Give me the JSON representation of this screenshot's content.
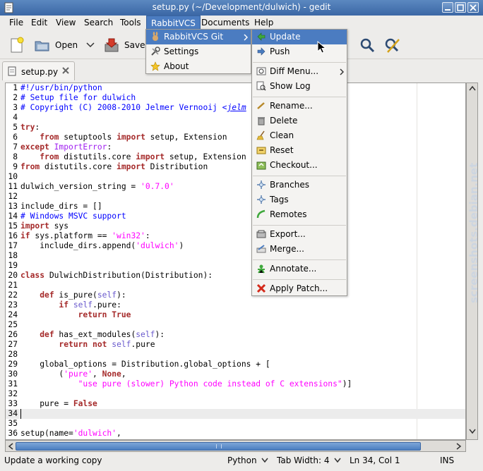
{
  "window": {
    "title": "setup.py (~/Development/dulwich) - gedit"
  },
  "menubar": {
    "items": [
      "File",
      "Edit",
      "View",
      "Search",
      "Tools",
      "RabbitVCS",
      "Documents",
      "Help"
    ]
  },
  "toolbar": {
    "open_label": "Open",
    "save_label": "Save"
  },
  "tab": {
    "filename": "setup.py"
  },
  "rabbitvcs_menu": {
    "items": [
      "RabbitVCS Git",
      "Settings",
      "About"
    ]
  },
  "git_submenu": {
    "items": [
      "Update",
      "Push",
      "Diff Menu...",
      "Show Log",
      "Rename...",
      "Delete",
      "Clean",
      "Reset",
      "Checkout...",
      "Branches",
      "Tags",
      "Remotes",
      "Export...",
      "Merge...",
      "Annotate...",
      "Apply Patch..."
    ]
  },
  "code": {
    "lines": [
      "#!/usr/bin/python",
      "# Setup file for dulwich",
      "# Copyright (C) 2008-2010 Jelmer Vernooij <jelm",
      "",
      "try:",
      "    from setuptools import setup, Extension",
      "except ImportError:",
      "    from distutils.core import setup, Extension",
      "from distutils.core import Distribution",
      "",
      "dulwich_version_string = '0.7.0'",
      "",
      "include_dirs = []",
      "# Windows MSVC support",
      "import sys",
      "if sys.platform == 'win32':",
      "    include_dirs.append('dulwich')",
      "",
      "",
      "class DulwichDistribution(Distribution):",
      "",
      "    def is_pure(self):",
      "        if self.pure:",
      "            return True",
      "",
      "    def has_ext_modules(self):",
      "        return not self.pure",
      "",
      "    global_options = Distribution.global_options + [",
      "        ('pure', None,",
      "            \"use pure (slower) Python code instead of C extensions\")]",
      "",
      "    pure = False",
      "",
      "",
      "setup(name='dulwich',"
    ],
    "line_numbers": [
      "1",
      "2",
      "3",
      "4",
      "5",
      "6",
      "7",
      "8",
      "9",
      "10",
      "11",
      "12",
      "13",
      "14",
      "15",
      "16",
      "17",
      "18",
      "19",
      "20",
      "21",
      "22",
      "23",
      "24",
      "25",
      "26",
      "27",
      "28",
      "29",
      "30",
      "31",
      "32",
      "33",
      "34",
      "35",
      "36"
    ],
    "current_line": 34
  },
  "watermark": "screenshots.debian.net",
  "statusbar": {
    "message": "Update a working copy",
    "language": "Python",
    "tab_width": "Tab Width:  4",
    "position": "Ln 34, Col 1",
    "mode": "INS"
  },
  "colors": {
    "selection": "#4b7cc1",
    "keyword": "#a52a2a",
    "string": "#ff00ff",
    "comment": "#0000ff"
  }
}
